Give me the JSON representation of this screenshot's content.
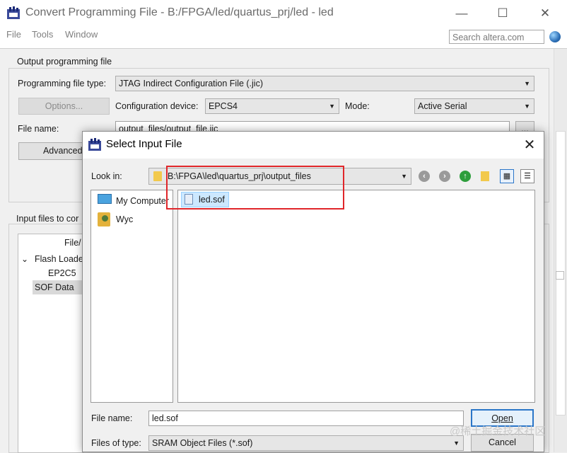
{
  "window": {
    "title": "Convert Programming File - B:/FPGA/led/quartus_prj/led - led",
    "minimize": "—",
    "maximize": "☐",
    "close": "✕"
  },
  "menu": {
    "items": [
      "File",
      "Tools",
      "Window"
    ]
  },
  "search": {
    "placeholder": "Search altera.com"
  },
  "output_section": {
    "title": "Output programming file",
    "file_type_label": "Programming file type:",
    "file_type_value": "JTAG Indirect Configuration File (.jic)",
    "options_button": "Options...",
    "config_device_label": "Configuration device:",
    "config_device_value": "EPCS4",
    "mode_label": "Mode:",
    "mode_value": "Active Serial",
    "file_name_label": "File name:",
    "file_name_value": "output_files/output_file.jic",
    "browse_button": "...",
    "advanced_button": "Advanced."
  },
  "input_section": {
    "title": "Input files to cor",
    "column_header": "File/",
    "tree": [
      "Flash Loade",
      "EP2C5",
      "SOF Data"
    ]
  },
  "dialog": {
    "title": "Select Input File",
    "close": "✕",
    "look_in_label": "Look in:",
    "look_in_value": "B:\\FPGA\\led\\quartus_prj\\output_files",
    "places": [
      "My Computer",
      "Wyc"
    ],
    "files": [
      "led.sof"
    ],
    "file_name_label": "File name:",
    "file_name_value": "led.sof",
    "files_of_type_label": "Files of type:",
    "files_of_type_value": "SRAM Object Files (*.sof)",
    "open_button": "Open",
    "cancel_button": "Cancel"
  },
  "watermark": "@稀土掘金技术社区",
  "colors": {
    "highlight_box": "#e0262a",
    "open_button_border": "#2b76c8",
    "selected_item": "#cce8ff"
  }
}
